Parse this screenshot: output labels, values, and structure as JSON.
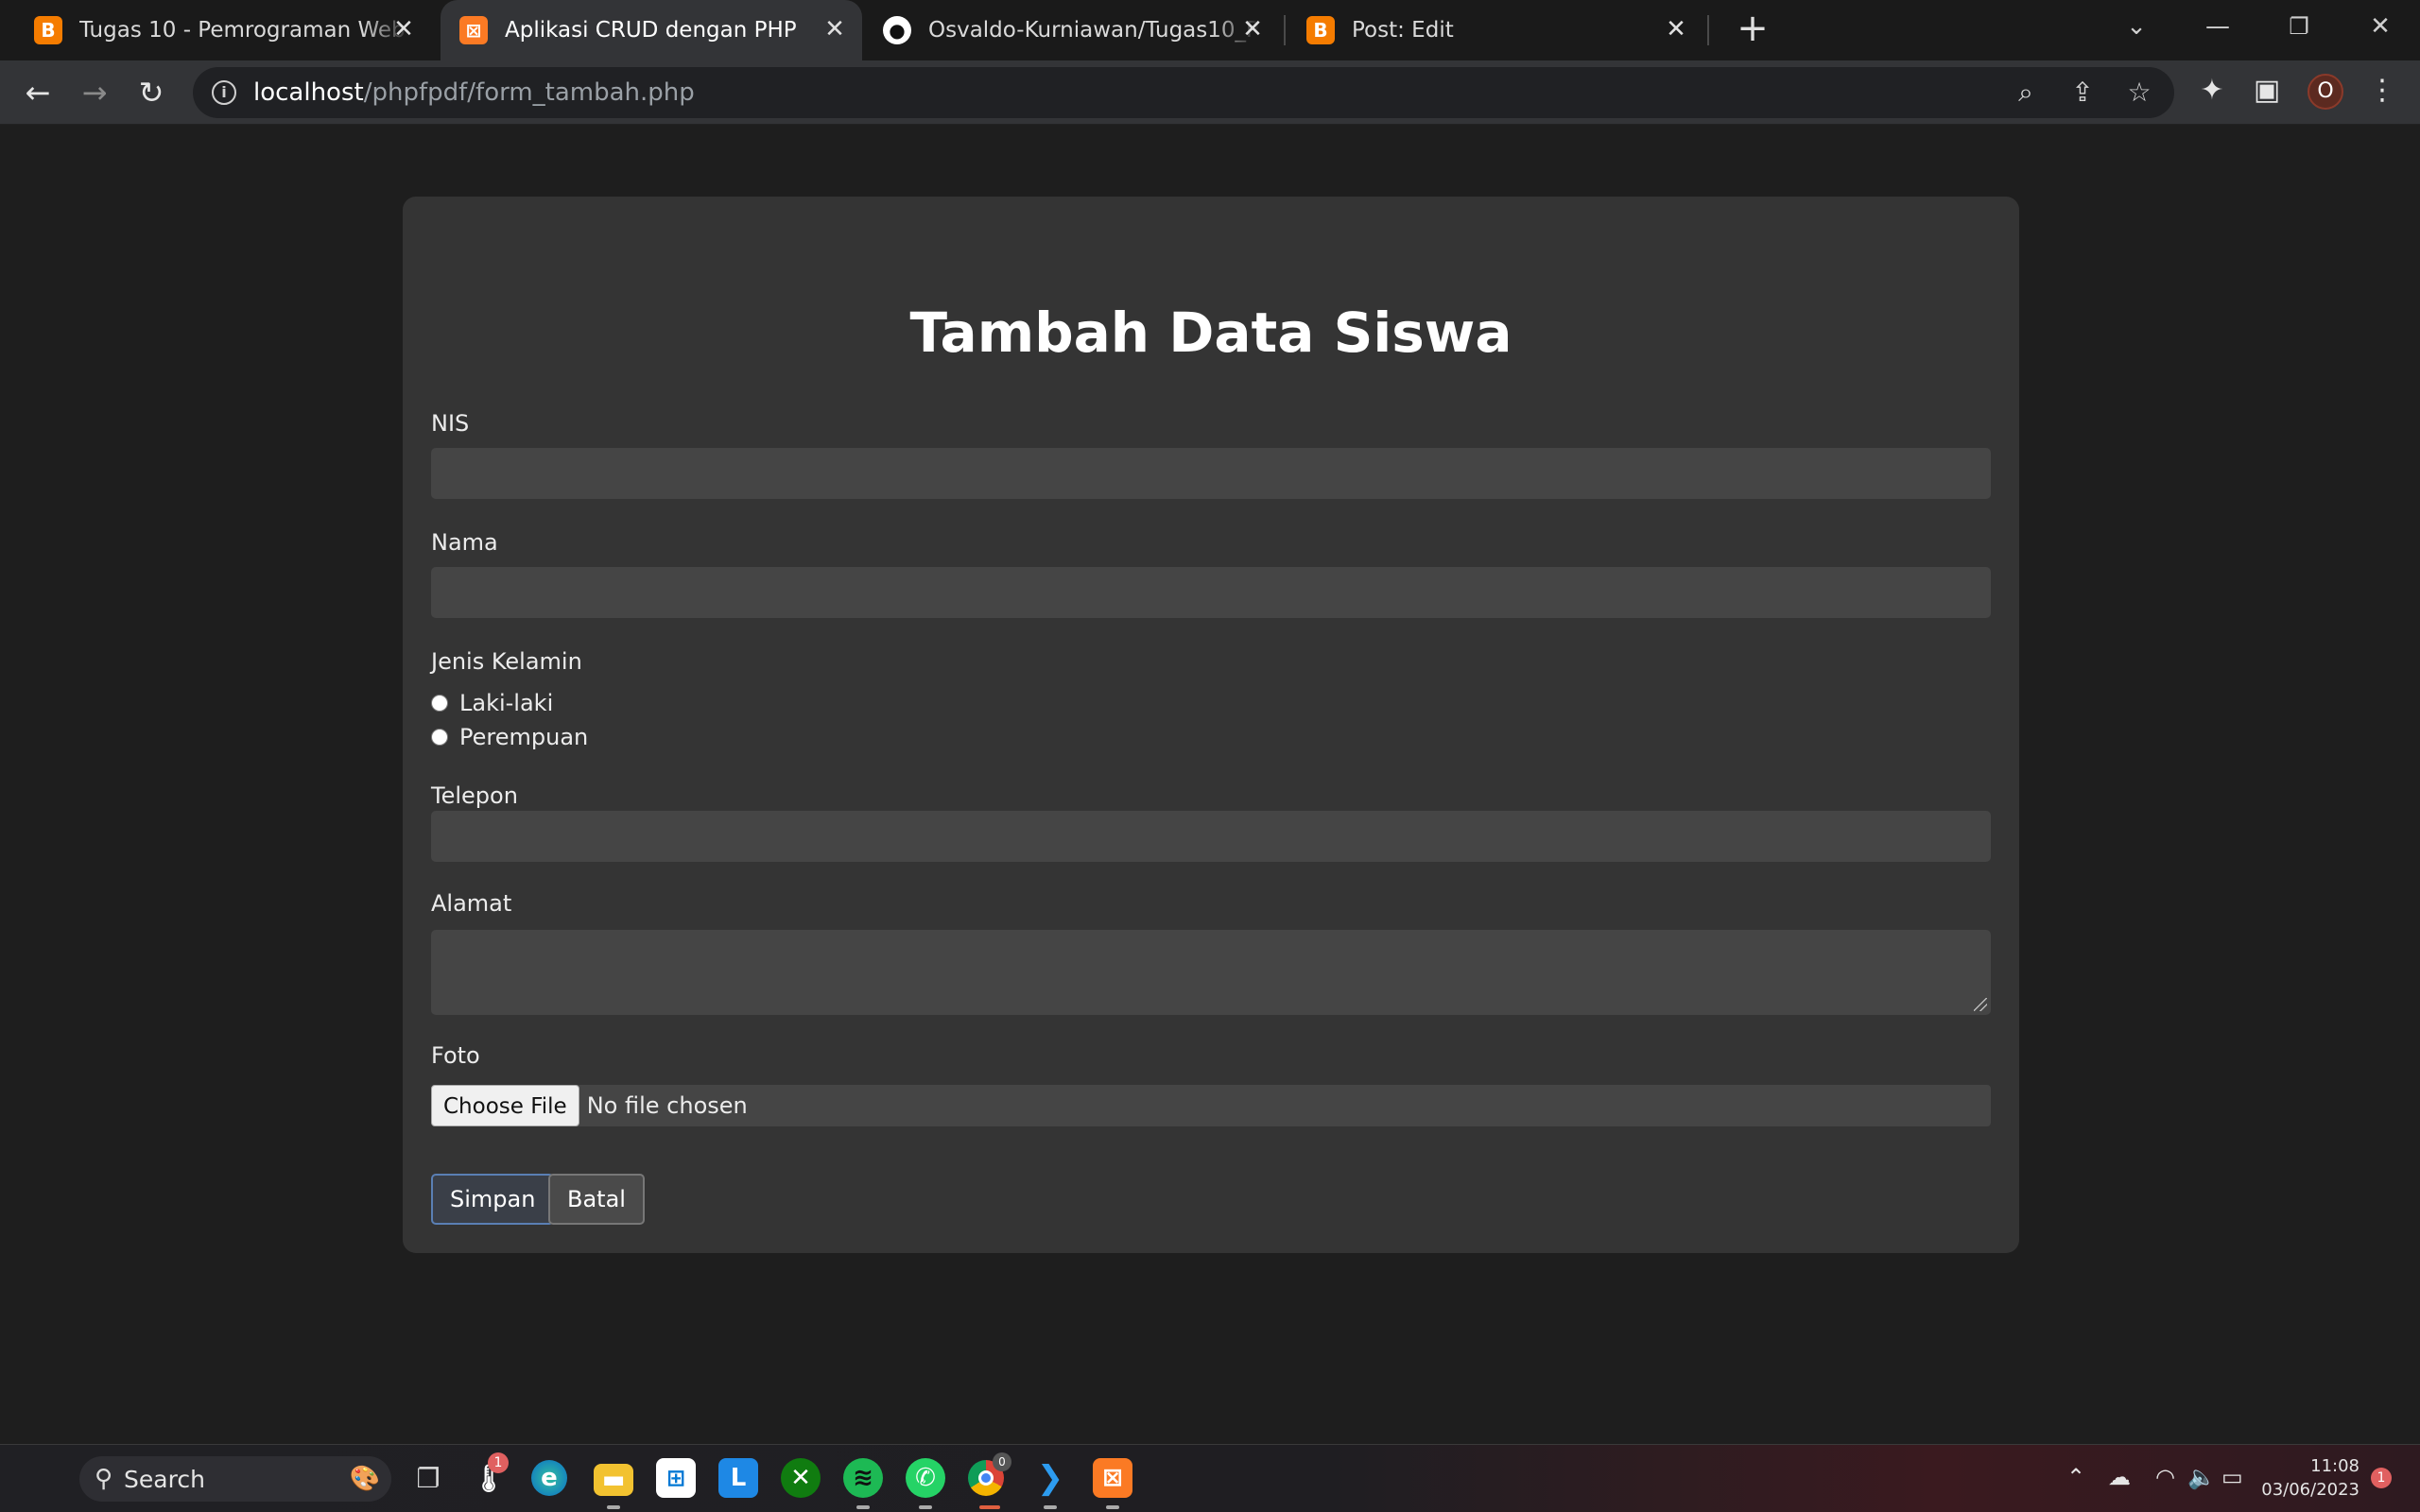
{
  "browser": {
    "tabs": [
      {
        "title": "Tugas 10 - Pemrograman Web (A",
        "favicon": "blogger-icon",
        "color": "#f57c00"
      },
      {
        "title": "Aplikasi CRUD dengan PHP",
        "favicon": "xampp-icon",
        "color": "#fb7a24"
      },
      {
        "title": "Osvaldo-Kurniawan/Tugas10_PW",
        "favicon": "github-icon",
        "color": "#ffffff"
      },
      {
        "title": "Post: Edit",
        "favicon": "blogger-icon",
        "color": "#f57c00"
      }
    ],
    "active_tab": 1,
    "url_host": "localhost",
    "url_path": "/phpfpdf/form_tambah.php",
    "profile_initial": "O"
  },
  "form": {
    "title": "Tambah Data Siswa",
    "nis_label": "NIS",
    "nama_label": "Nama",
    "jk_label": "Jenis Kelamin",
    "jk_options": [
      "Laki-laki",
      "Perempuan"
    ],
    "telepon_label": "Telepon",
    "alamat_label": "Alamat",
    "foto_label": "Foto",
    "file_button": "Choose File",
    "file_status": "No file chosen",
    "save_label": "Simpan",
    "cancel_label": "Batal"
  },
  "taskbar": {
    "search_label": "Search",
    "time": "11:08",
    "date": "03/06/2023",
    "notification_count": "1",
    "weather_badge": "1",
    "chrome_badge": "0"
  }
}
